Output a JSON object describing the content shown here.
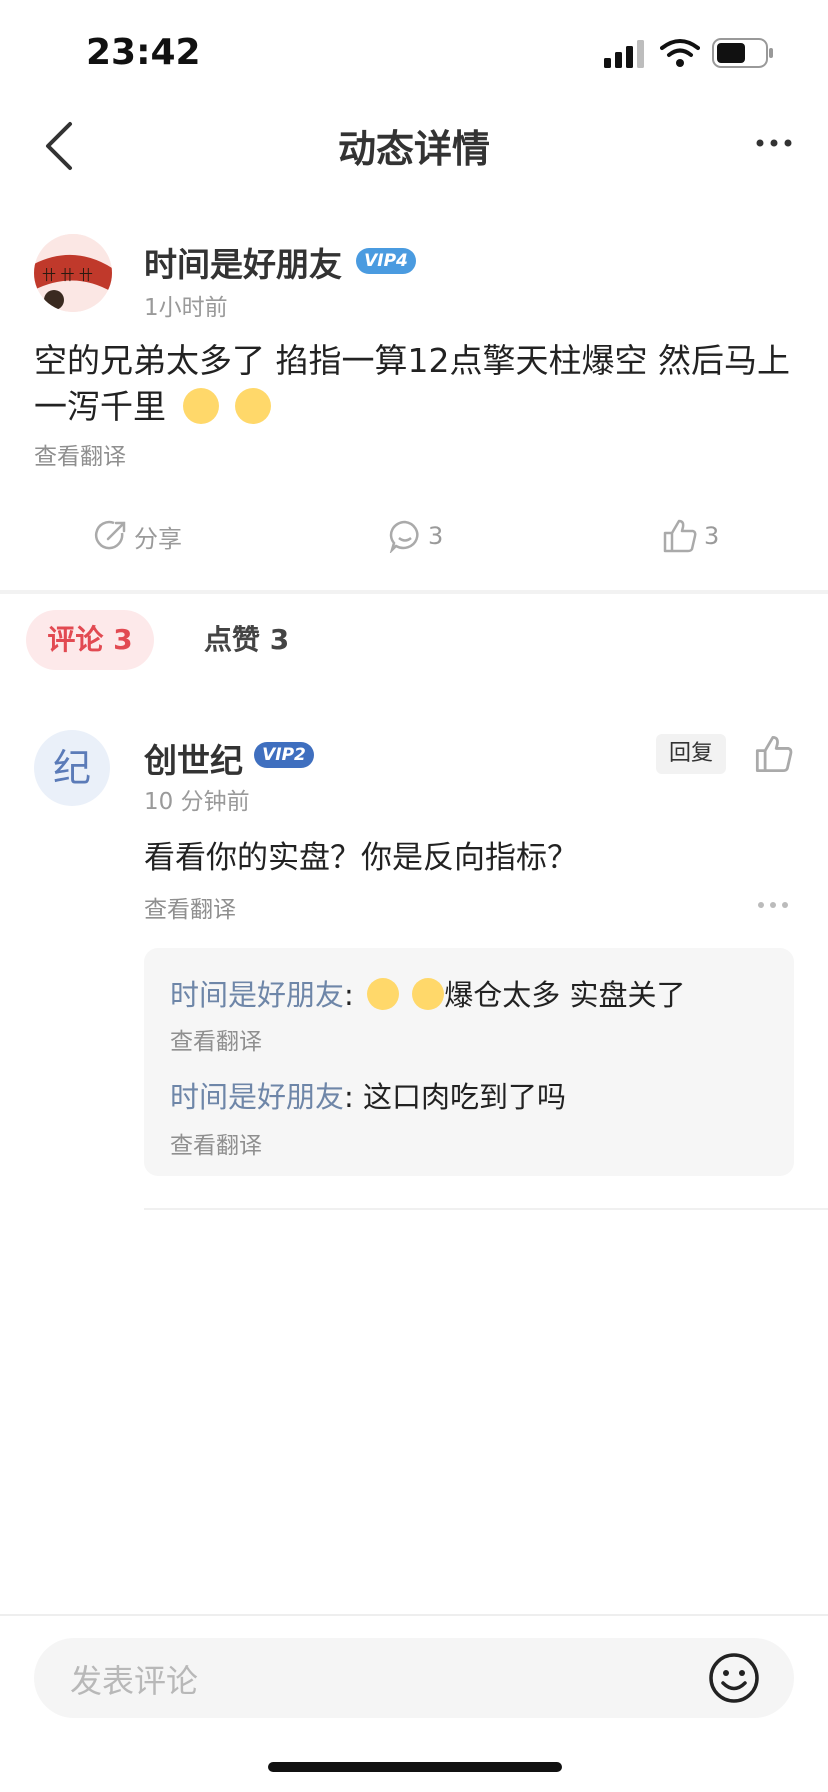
{
  "status_bar": {
    "time": "23:42"
  },
  "header": {
    "title": "动态详情"
  },
  "post": {
    "author": "时间是好朋友",
    "vip_badge": "VIP4",
    "time": "1小时前",
    "text": "空的兄弟太多了 掐指一算12点擎天柱爆空 然后马上一泻千里",
    "translate": "查看翻译",
    "share_label": "分享",
    "comment_count": "3",
    "like_count": "3"
  },
  "tabs": {
    "comments": "评论 3",
    "likes": "点赞 3"
  },
  "comment": {
    "avatar_char": "纪",
    "author": "创世纪",
    "vip_badge": "VIP2",
    "time": "10 分钟前",
    "reply_label": "回复",
    "text": "看看你的实盘？你是反向指标？",
    "translate": "查看翻译",
    "replies": [
      {
        "user": "时间是好朋友",
        "sep": ": ",
        "text": "爆仓太多 实盘关了",
        "translate": "查看翻译"
      },
      {
        "user": "时间是好朋友",
        "sep": ": ",
        "text": "这口肉吃到了吗",
        "translate": "查看翻译"
      }
    ]
  },
  "composer": {
    "placeholder": "发表评论"
  },
  "colors": {
    "accent": "#e24a52",
    "vip4": "#4a9be0",
    "vip2": "#3f6fbf",
    "reply_user": "#6e86a8"
  }
}
